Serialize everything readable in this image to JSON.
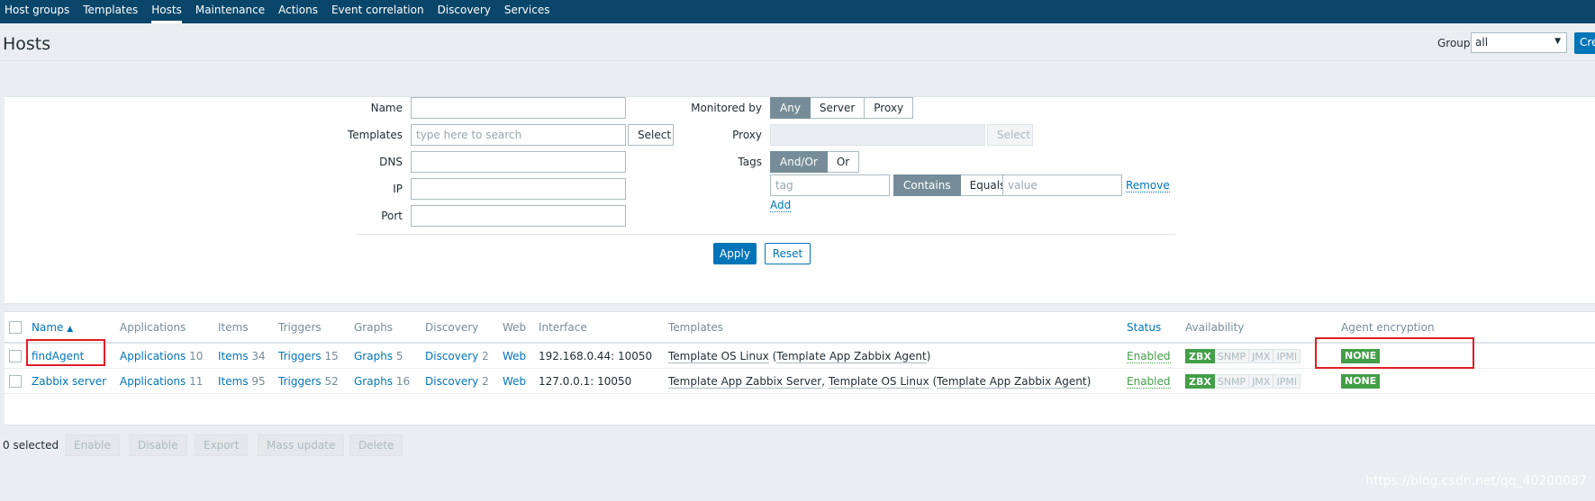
{
  "nav": {
    "items": [
      "Host groups",
      "Templates",
      "Hosts",
      "Maintenance",
      "Actions",
      "Event correlation",
      "Discovery",
      "Services"
    ],
    "active_index": 2
  },
  "header": {
    "title": "Hosts",
    "group_label": "Group",
    "group_value": "all",
    "create_label": "Create host"
  },
  "filter": {
    "name_label": "Name",
    "name_value": "",
    "templates_label": "Templates",
    "templates_placeholder": "type here to search",
    "templates_select": "Select",
    "dns_label": "DNS",
    "dns_value": "",
    "ip_label": "IP",
    "ip_value": "",
    "port_label": "Port",
    "port_value": "",
    "monitored_label": "Monitored by",
    "monitored_options": [
      "Any",
      "Server",
      "Proxy"
    ],
    "monitored_selected": "Any",
    "proxy_label": "Proxy",
    "proxy_select": "Select",
    "tags_label": "Tags",
    "tags_options": [
      "And/Or",
      "Or"
    ],
    "tags_selected": "And/Or",
    "tag_placeholder": "tag",
    "tag_ops": [
      "Contains",
      "Equals"
    ],
    "tag_op_selected": "Contains",
    "value_placeholder": "value",
    "remove_label": "Remove",
    "add_label": "Add",
    "apply_label": "Apply",
    "reset_label": "Reset"
  },
  "table": {
    "columns": {
      "name": "Name",
      "sort_indicator": "▲",
      "applications": "Applications",
      "items": "Items",
      "triggers": "Triggers",
      "graphs": "Graphs",
      "discovery": "Discovery",
      "web": "Web",
      "interface": "Interface",
      "templates": "Templates",
      "status": "Status",
      "availability": "Availability",
      "encryption": "Agent encryption"
    },
    "rows": [
      {
        "name": "findAgent",
        "applications": "Applications",
        "applications_count": "10",
        "items": "Items",
        "items_count": "34",
        "triggers": "Triggers",
        "triggers_count": "15",
        "graphs": "Graphs",
        "graphs_count": "5",
        "discovery": "Discovery",
        "discovery_count": "2",
        "web": "Web",
        "interface": "192.168.0.44: 10050",
        "templates": {
          "t1": "Template OS Linux",
          "open": " (",
          "t2": "Template App Zabbix Agent",
          "close": ")"
        },
        "status": "Enabled",
        "availability": [
          "ZBX",
          "SNMP",
          "JMX",
          "IPMI"
        ],
        "encryption": "NONE"
      },
      {
        "name": "Zabbix server",
        "applications": "Applications",
        "applications_count": "11",
        "items": "Items",
        "items_count": "95",
        "triggers": "Triggers",
        "triggers_count": "52",
        "graphs": "Graphs",
        "graphs_count": "16",
        "discovery": "Discovery",
        "discovery_count": "2",
        "web": "Web",
        "interface": "127.0.0.1: 10050",
        "templates": {
          "t1": "Template App Zabbix Server",
          "sep": ", ",
          "t2": "Template OS Linux",
          "open": " (",
          "t3": "Template App Zabbix Agent",
          "close": ")"
        },
        "status": "Enabled",
        "availability": [
          "ZBX",
          "SNMP",
          "JMX",
          "IPMI"
        ],
        "encryption": "NONE"
      }
    ]
  },
  "footer": {
    "selected": "0 selected",
    "actions": [
      "Enable",
      "Disable",
      "Export",
      "Mass update",
      "Delete"
    ]
  },
  "watermark": "https://blog.csdn.net/qq_40200087",
  "colors": {
    "nav_bg": "#0a466a",
    "primary": "#0275b8",
    "enabled_green": "#429e47",
    "highlight_red": "#e01e25",
    "selected_toggle": "#768d99"
  }
}
